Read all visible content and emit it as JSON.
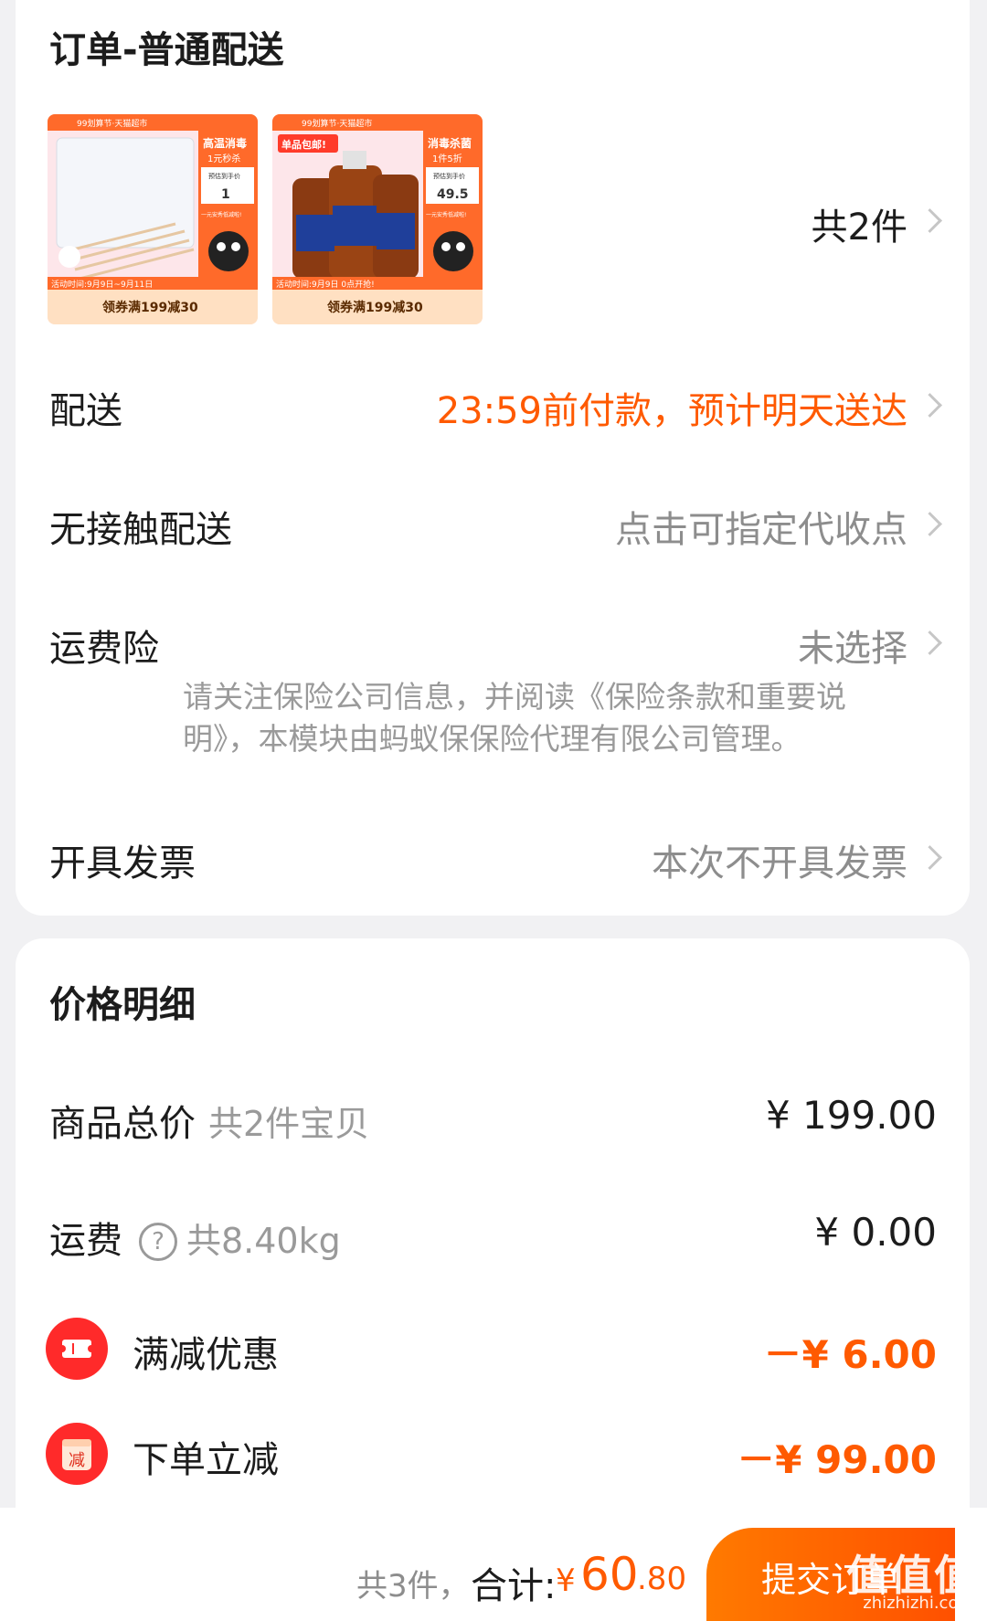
{
  "order": {
    "title": "订单-普通配送",
    "products": [
      {
        "badge": "99划算节·天猫超市",
        "tag_title": "高温消毒",
        "tag_sub": "1元秒杀",
        "price_label": "预估到手价",
        "price": "1",
        "promo": "一元安秀低减啦!",
        "period": "活动时间:9月9日~9月11日",
        "coupon": "领券满199减30"
      },
      {
        "badge": "99划算节·天猫超市",
        "ribbon": "单品包邮!",
        "tag_title": "消毒杀菌",
        "tag_sub": "1件5折",
        "price_label": "预估到手价",
        "price": "49.5",
        "promo": "一元安秀低减啦!",
        "period": "活动时间:9月9日 0点开抢!",
        "coupon": "领券满199减30"
      }
    ],
    "item_count": "共2件",
    "delivery": {
      "label": "配送",
      "value": "23:59前付款，预计明天送达"
    },
    "contactless": {
      "label": "无接触配送",
      "value": "点击可指定代收点"
    },
    "insurance": {
      "label": "运费险",
      "value": "未选择",
      "note": "请关注保险公司信息，并阅读《保险条款和重要说明》，本模块由蚂蚁保保险代理有限公司管理。"
    },
    "invoice": {
      "label": "开具发票",
      "value": "本次不开具发票"
    }
  },
  "price": {
    "title": "价格明细",
    "goods": {
      "label": "商品总价",
      "sub": "共2件宝贝",
      "amount": "¥ 199.00"
    },
    "shipping": {
      "label": "运费",
      "sub": "共8.40kg",
      "amount": "¥ 0.00"
    },
    "full_reduction": {
      "label": "满减优惠",
      "amount": "－¥ 6.00"
    },
    "instant_discount": {
      "label": "下单立减",
      "icon_text": "减",
      "amount": "－¥ 99.00"
    }
  },
  "footer": {
    "count": "共3件，",
    "total_label": "合计:",
    "total_yen": "¥",
    "total_int": "60",
    "total_dec": ".80",
    "submit": "提交订单"
  },
  "watermark": {
    "text": "值值值",
    "url": "zhizhizhi.com"
  },
  "colors": {
    "accent": "#ff5a00",
    "discount_red": "#ff2a2a",
    "background": "#f1f1f3"
  }
}
